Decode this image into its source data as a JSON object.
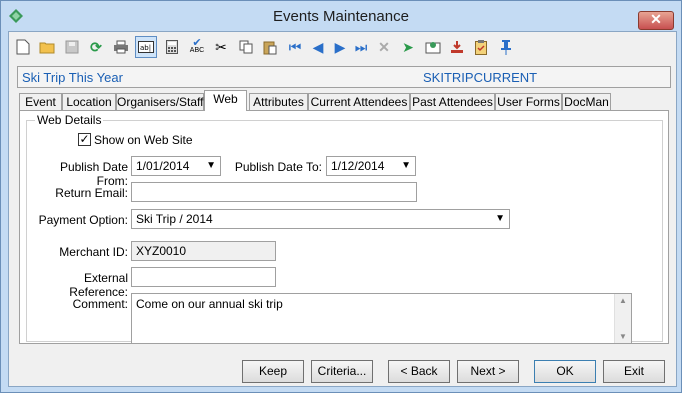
{
  "window": {
    "title": "Events Maintenance"
  },
  "toolbar": {
    "icons": [
      "new-icon",
      "open-icon",
      "save-icon",
      "refresh-icon",
      "print-icon",
      "text-field-icon",
      "calculator-icon",
      "spellcheck-icon",
      "cut-icon",
      "copy-icon",
      "paste-icon",
      "first-record-icon",
      "previous-record-icon",
      "next-record-icon",
      "last-record-icon",
      "delete-icon",
      "approve-icon",
      "certificate-icon",
      "download-icon",
      "clipboard-icon",
      "pin-icon"
    ],
    "spell_label": "ABC"
  },
  "record": {
    "name": "Ski Trip This Year",
    "code": "SKITRIPCURRENT"
  },
  "tabs": [
    "Event",
    "Location",
    "Organisers/Staff",
    "Web",
    "Attributes",
    "Current Attendees",
    "Past Attendees",
    "User Forms",
    "DocMan"
  ],
  "web": {
    "group_title": "Web Details",
    "show_on_web_label": "Show on Web Site",
    "show_on_web_checked": "✓",
    "publish_from_label": "Publish Date From:",
    "publish_from_value": "1/01/2014",
    "publish_to_label": "Publish Date To:",
    "publish_to_value": "1/12/2014",
    "return_email_label": "Return Email:",
    "return_email_value": "",
    "payment_option_label": "Payment Option:",
    "payment_option_value": "Ski Trip / 2014",
    "merchant_id_label": "Merchant ID:",
    "merchant_id_value": "XYZ0010",
    "external_ref_label": "External Reference:",
    "external_ref_value": "",
    "comment_label": "Comment:",
    "comment_value": "Come on our annual ski trip"
  },
  "buttons": {
    "keep": "Keep",
    "criteria": "Criteria...",
    "back": "< Back",
    "next": "Next >",
    "ok": "OK",
    "exit": "Exit"
  }
}
